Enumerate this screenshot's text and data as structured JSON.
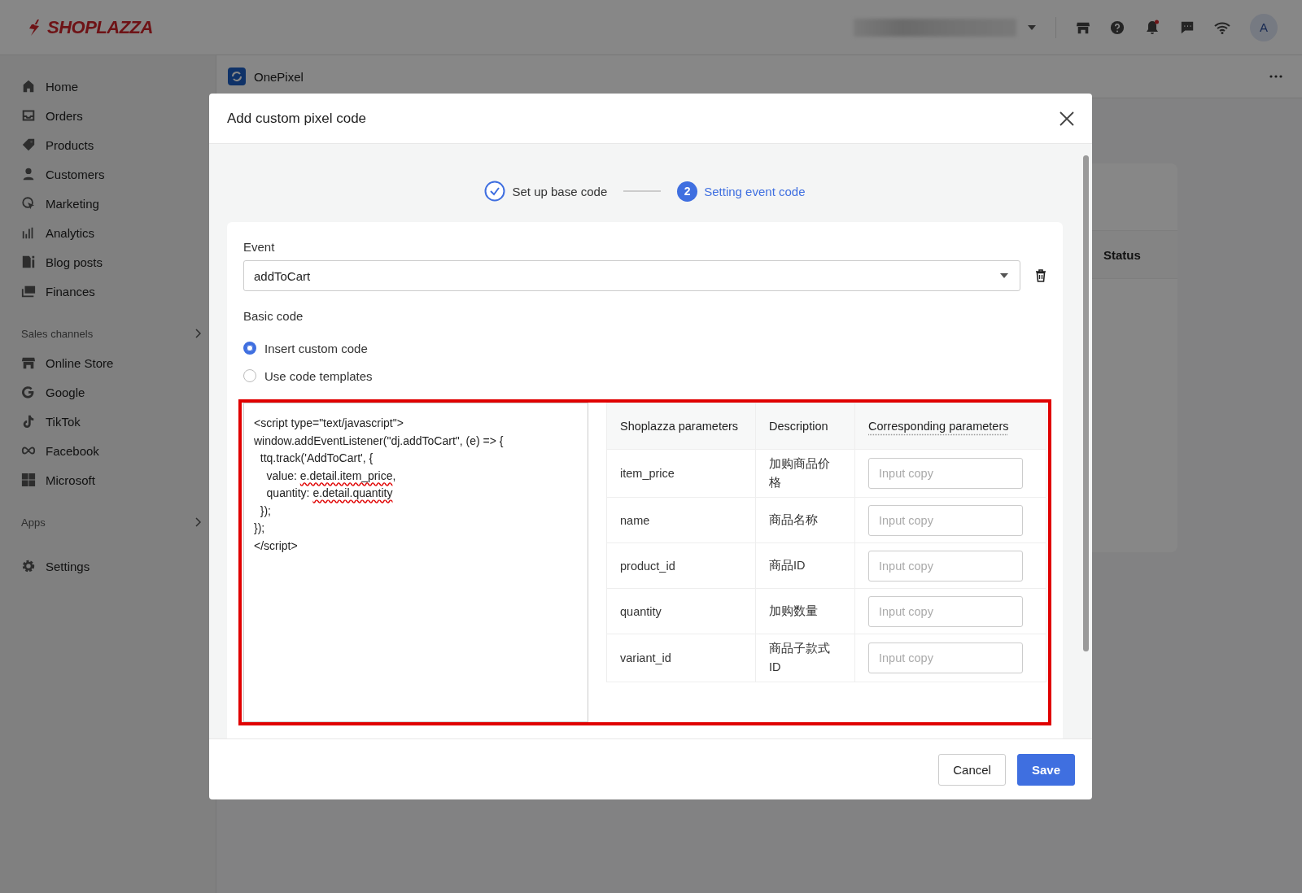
{
  "topbar": {
    "logo": "SHOPLAZZA",
    "avatar": "A",
    "notification_dot": true
  },
  "sidebar": {
    "items": [
      {
        "label": "Home"
      },
      {
        "label": "Orders"
      },
      {
        "label": "Products"
      },
      {
        "label": "Customers"
      },
      {
        "label": "Marketing"
      },
      {
        "label": "Analytics"
      },
      {
        "label": "Blog posts"
      },
      {
        "label": "Finances"
      }
    ],
    "sections": [
      {
        "title": "Sales channels",
        "items": [
          {
            "label": "Online Store"
          },
          {
            "label": "Google"
          },
          {
            "label": "TikTok"
          },
          {
            "label": "Facebook"
          },
          {
            "label": "Microsoft"
          }
        ]
      },
      {
        "title": "Apps"
      }
    ],
    "footer_item": {
      "label": "Settings"
    }
  },
  "page": {
    "app_name": "OnePixel",
    "column_header": "Status"
  },
  "modal": {
    "title": "Add custom pixel code",
    "steps": [
      {
        "label": "Set up base code",
        "completed": true,
        "selected": false
      },
      {
        "label": "Setting event code",
        "number": "2",
        "completed": false,
        "selected": true
      }
    ],
    "event": {
      "label": "Event",
      "value": "addToCart"
    },
    "basic_code": {
      "label": "Basic code",
      "options": [
        {
          "label": "Insert custom code",
          "selected": true
        },
        {
          "label": "Use code templates",
          "selected": false
        }
      ]
    },
    "code_lines": [
      [
        {
          "text": "<script type=\"text/javascript\">"
        }
      ],
      [
        {
          "text": "window.addEventListener(\"dj.addToCart\", (e) => {"
        }
      ],
      [
        {
          "text": "  ttq.track('AddToCart', {"
        }
      ],
      [
        {
          "text": "    value: "
        },
        {
          "text": "e.detail.item_price",
          "misspelled": true
        },
        {
          "text": ","
        }
      ],
      [
        {
          "text": "    quantity: "
        },
        {
          "text": "e.detail.quantity",
          "misspelled": true
        }
      ],
      [
        {
          "text": "  });"
        }
      ],
      [
        {
          "text": "});"
        }
      ],
      [
        {
          "text": "</script>"
        }
      ]
    ],
    "table": {
      "columns": [
        "Shoplazza parameters",
        "Description",
        "Corresponding parameters"
      ],
      "rows": [
        {
          "parameter": "item_price",
          "description": "加购商品价格",
          "placeholder": "Input copy"
        },
        {
          "parameter": "name",
          "description": "商品名称",
          "placeholder": "Input copy"
        },
        {
          "parameter": "product_id",
          "description": "商品ID",
          "placeholder": "Input copy"
        },
        {
          "parameter": "quantity",
          "description": "加购数量",
          "placeholder": "Input copy"
        },
        {
          "parameter": "variant_id",
          "description": "商品子款式ID",
          "placeholder": "Input copy"
        }
      ]
    },
    "highlighted": true,
    "buttons": [
      {
        "label": "Cancel",
        "kind": "secondary"
      },
      {
        "label": "Save",
        "kind": "primary"
      }
    ]
  }
}
